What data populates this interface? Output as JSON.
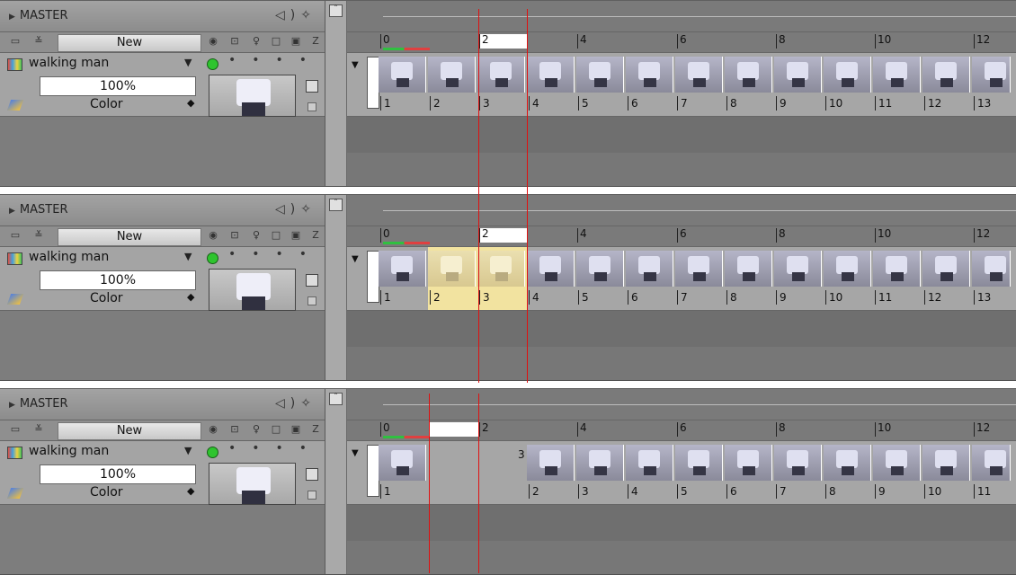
{
  "panels": [
    {
      "master_title": "MASTER",
      "new_label": "New",
      "z_label": "Z",
      "layer_name": "walking man",
      "opacity": "100%",
      "blend": "Color",
      "ruler_labels": [
        "0",
        "2",
        "4",
        "6",
        "8",
        "10",
        "12"
      ],
      "frame_labels": [
        "1",
        "2",
        "3",
        "4",
        "5",
        "6",
        "7",
        "8",
        "9",
        "10",
        "11",
        "12",
        "13"
      ],
      "hold_label": ""
    },
    {
      "master_title": "MASTER",
      "new_label": "New",
      "z_label": "Z",
      "layer_name": "walking man",
      "opacity": "100%",
      "blend": "Color",
      "ruler_labels": [
        "0",
        "2",
        "4",
        "6",
        "8",
        "10",
        "12"
      ],
      "frame_labels": [
        "1",
        "2",
        "3",
        "4",
        "5",
        "6",
        "7",
        "8",
        "9",
        "10",
        "11",
        "12",
        "13"
      ],
      "hold_label": ""
    },
    {
      "master_title": "MASTER",
      "new_label": "New",
      "z_label": "Z",
      "layer_name": "walking man",
      "opacity": "100%",
      "blend": "Color",
      "ruler_labels": [
        "0",
        "2",
        "4",
        "6",
        "8",
        "10",
        "12"
      ],
      "frame_labels": [
        "1",
        "2",
        "3",
        "4",
        "5",
        "6",
        "7",
        "8",
        "9",
        "10",
        "11"
      ],
      "hold_label": "3"
    }
  ],
  "icons": {
    "expand": "triangle-right-icon",
    "sound": "speaker-icon",
    "onion": "onion-skin-icon",
    "folder": "folder-icon",
    "eye": "eye-icon",
    "lock": "lock-icon",
    "light": "lightbulb-icon",
    "layer_dropdown": "chevron-down-icon",
    "status": "green-dot-icon"
  },
  "colors": {
    "playhead": "#e01010",
    "selection": "#f2e3a0",
    "status_green": "#2ec42e"
  }
}
